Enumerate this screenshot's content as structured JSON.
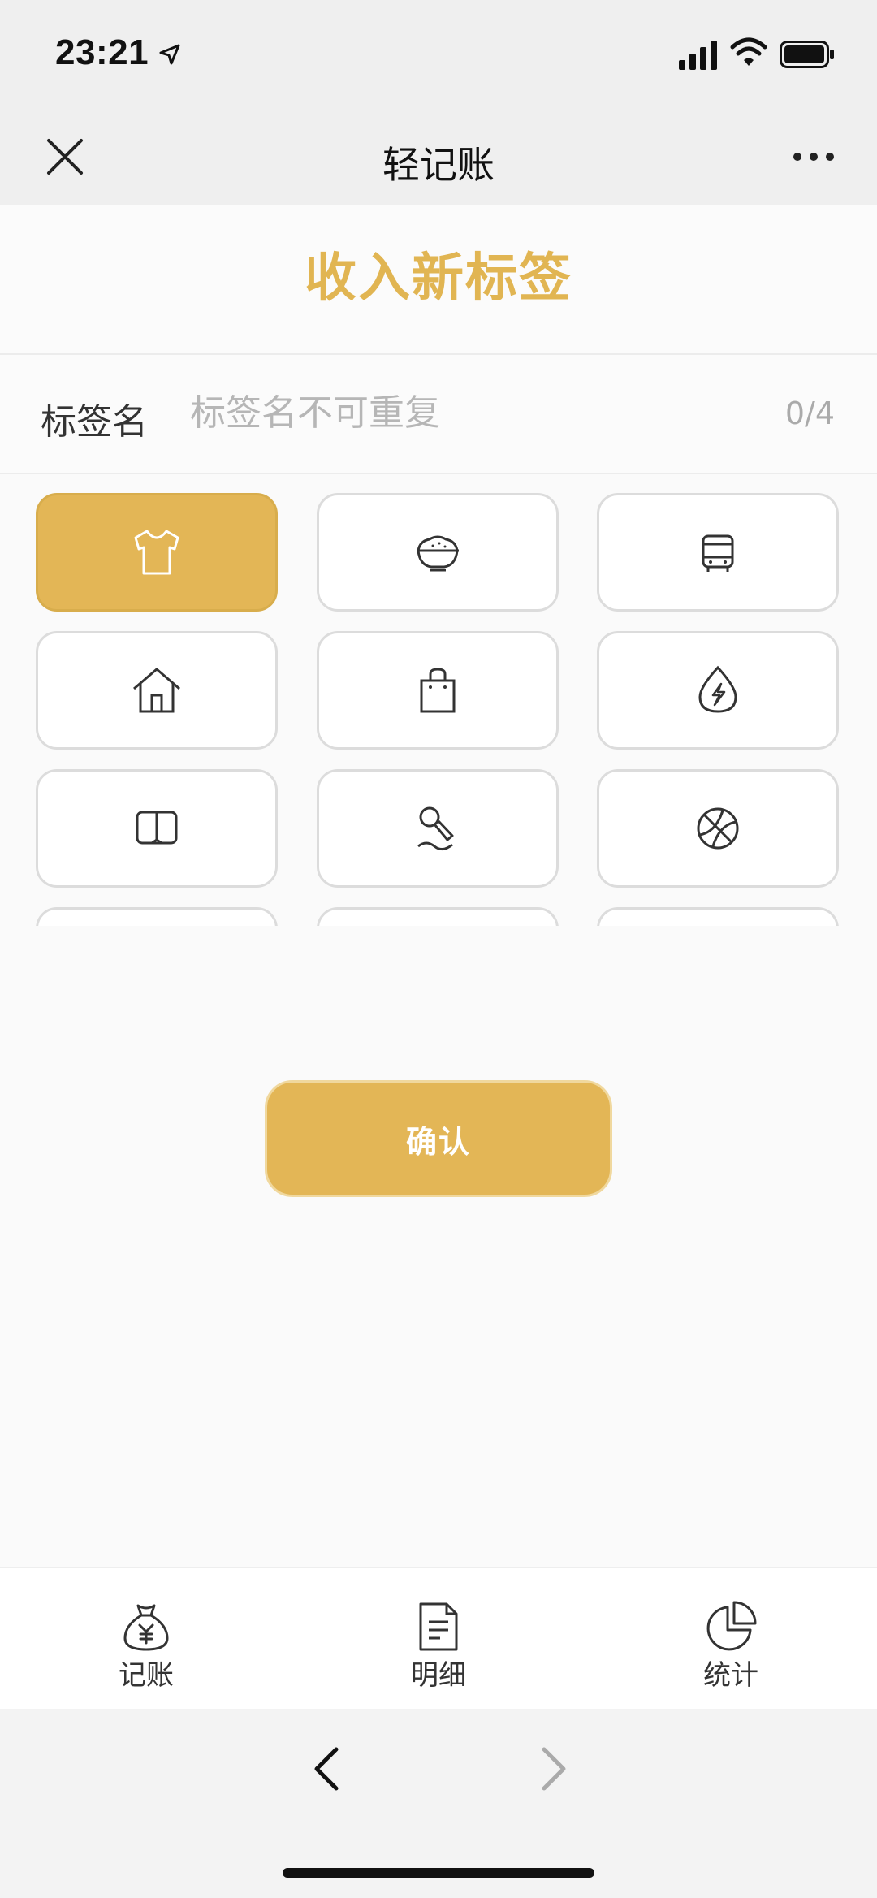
{
  "status_bar": {
    "time": "23:21",
    "icons": [
      "location-arrow-icon",
      "signal-icon",
      "wifi-icon",
      "battery-icon"
    ]
  },
  "nav": {
    "title": "轻记账",
    "close_icon": "close-icon",
    "more_icon": "more-icon"
  },
  "heading": {
    "title": "收入新标签"
  },
  "tag_form": {
    "label": "标签名",
    "placeholder": "标签名不可重复",
    "value": "",
    "counter": "0/4"
  },
  "icon_grid": {
    "items": [
      {
        "icon": "tshirt-icon",
        "selected": true
      },
      {
        "icon": "rice-bowl-icon",
        "selected": false
      },
      {
        "icon": "bus-icon",
        "selected": false
      },
      {
        "icon": "house-icon",
        "selected": false
      },
      {
        "icon": "shopping-bag-icon",
        "selected": false
      },
      {
        "icon": "utility-drop-icon",
        "selected": false
      },
      {
        "icon": "book-icon",
        "selected": false
      },
      {
        "icon": "microphone-icon",
        "selected": false
      },
      {
        "icon": "basketball-icon",
        "selected": false
      }
    ]
  },
  "confirm": {
    "label": "确认"
  },
  "tabs": [
    {
      "label": "记账",
      "icon": "money-bag-icon"
    },
    {
      "label": "明细",
      "icon": "document-icon"
    },
    {
      "label": "统计",
      "icon": "pie-chart-icon"
    }
  ],
  "colors": {
    "accent": "#e3b656",
    "heading": "#e1b552",
    "text": "#333333",
    "placeholder": "#b6b6b6"
  }
}
